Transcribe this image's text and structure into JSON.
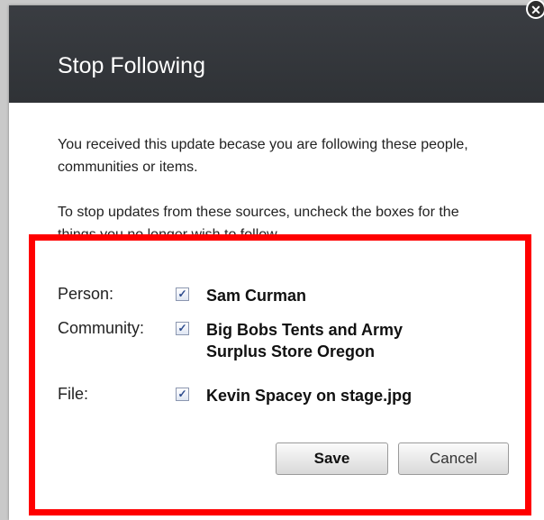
{
  "dialog": {
    "title": "Stop Following",
    "close_symbol": "✕",
    "description1": "You received this update becase you are following these people, communities or items.",
    "description2": "To stop updates from these sources, uncheck the boxes for the things you no longer wish to follow."
  },
  "items": [
    {
      "label": "Person:",
      "value": "Sam Curman",
      "checked": true
    },
    {
      "label": "Community:",
      "value_line1": "Big Bobs Tents and Army",
      "value_line2": "Surplus Store Oregon",
      "checked": true
    },
    {
      "label": "File:",
      "value": "Kevin Spacey on stage.jpg",
      "checked": true
    }
  ],
  "check_symbol": "✓",
  "buttons": {
    "save": "Save",
    "cancel": "Cancel"
  },
  "colors": {
    "header_bg": "#2f3236",
    "highlight": "#ff0000"
  }
}
